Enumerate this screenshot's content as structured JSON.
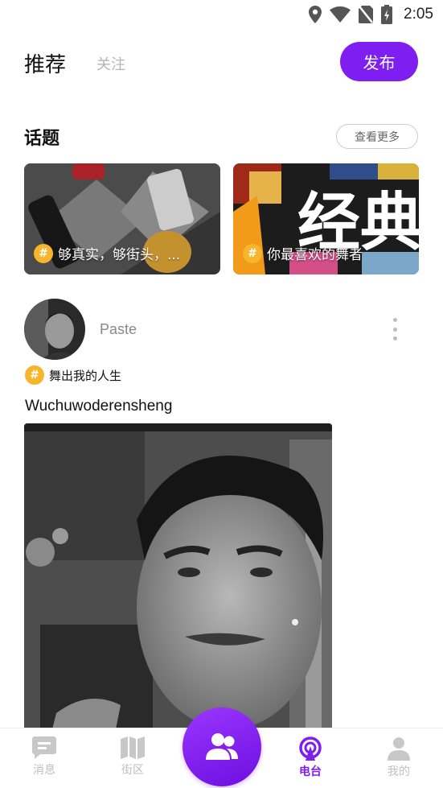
{
  "status_bar": {
    "time": "2:05",
    "icons": [
      "location-icon",
      "wifi-icon",
      "no-sim-icon",
      "battery-charging-icon"
    ]
  },
  "header": {
    "tab_active": "推荐",
    "tab_inactive": "关注",
    "publish_label": "发布"
  },
  "topics": {
    "title": "话题",
    "more_label": "查看更多",
    "cards": [
      {
        "label": "够真实，够街头，...",
        "badge": "#"
      },
      {
        "label": "你最喜欢的舞者",
        "badge": "#",
        "image_text": "经典"
      }
    ]
  },
  "post": {
    "username": "Paste",
    "tag": "舞出我的人生",
    "tag_badge": "#",
    "text": "Wuchuwoderensheng"
  },
  "bottom_nav": {
    "items": [
      {
        "label": "消息",
        "icon": "message-icon"
      },
      {
        "label": "街区",
        "icon": "map-icon"
      },
      {
        "label": "",
        "icon": "people-icon"
      },
      {
        "label": "电台",
        "icon": "radio-icon",
        "active": true
      },
      {
        "label": "我的",
        "icon": "user-icon"
      }
    ],
    "accent_color": "#7e1ef0",
    "inactive_color": "#bfbfbf"
  }
}
